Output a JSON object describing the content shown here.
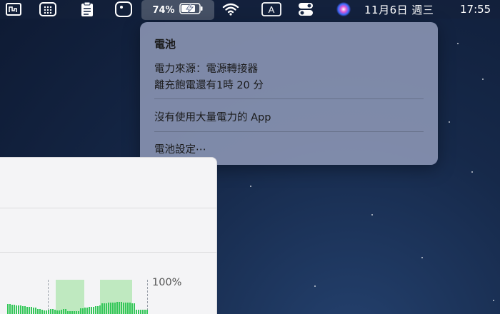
{
  "menubar": {
    "battery_percent": "74%",
    "date": "11月6日 週三",
    "time": "17:55",
    "icons": [
      "activity-monitor-icon",
      "keypad-icon",
      "clipboard-icon",
      "screen-record-icon",
      "battery-charging-icon",
      "wifi-icon",
      "input-method-icon",
      "control-center-icon",
      "siri-icon"
    ],
    "input_method_label": "A"
  },
  "battery_menu": {
    "title": "電池",
    "power_source": "電力來源：電源轉接器",
    "time_to_full": "離充飽電還有1時 20 分",
    "apps_status": "沒有使用大量電力的 App",
    "settings_label": "電池設定⋯"
  },
  "background_window": {
    "chart_label": "100%",
    "charge_level": 0.74
  }
}
